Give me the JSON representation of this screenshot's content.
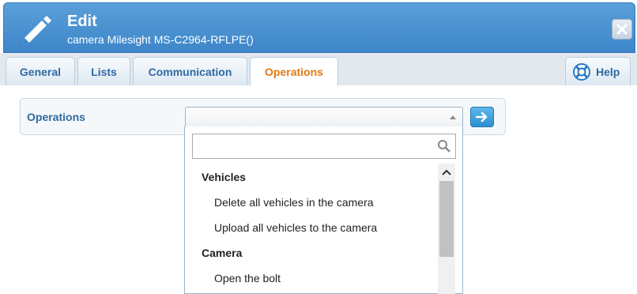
{
  "header": {
    "title": "Edit",
    "subtitle": "camera Milesight MS-C2964-RFLPE()"
  },
  "tabs": [
    {
      "label": "General"
    },
    {
      "label": "Lists"
    },
    {
      "label": "Communication"
    },
    {
      "label": "Operations",
      "active": true
    }
  ],
  "help_label": "Help",
  "operations": {
    "label": "Operations",
    "selected": ""
  },
  "dropdown": {
    "search_placeholder": "",
    "groups": [
      {
        "label": "Vehicles",
        "options": [
          "Delete all vehicles in the camera",
          "Upload all vehicles to the camera"
        ]
      },
      {
        "label": "Camera",
        "options": [
          "Open the bolt"
        ]
      }
    ]
  },
  "colors": {
    "header": "#4a93d3",
    "tab_text": "#2f6aa3",
    "active_tab_text": "#e07a14",
    "go_button": "#2a8fd0"
  }
}
